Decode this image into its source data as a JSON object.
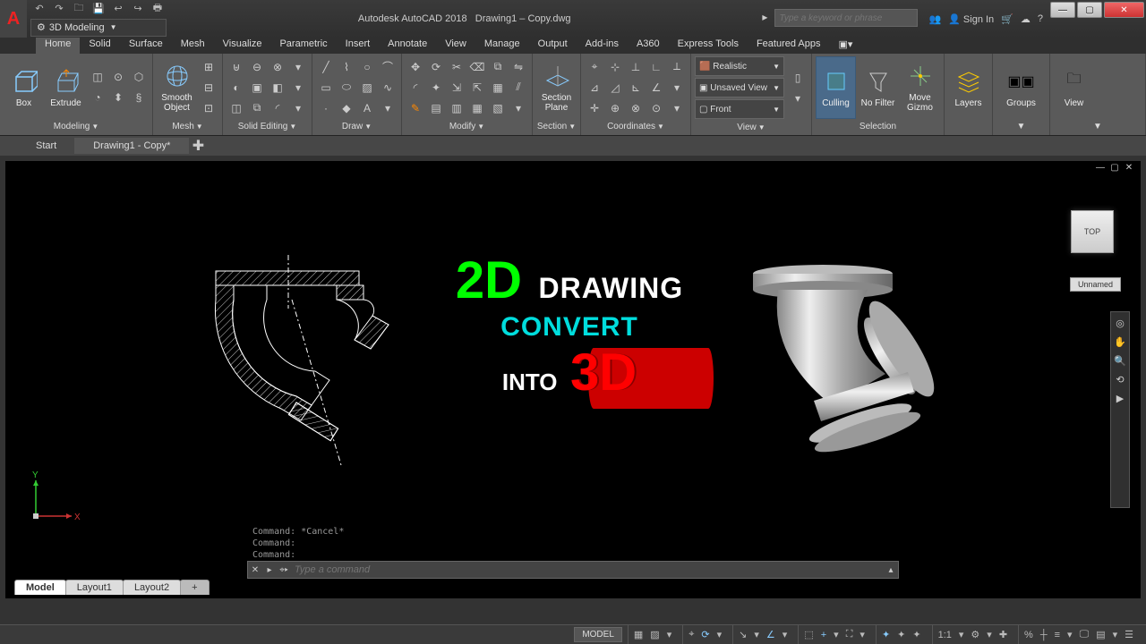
{
  "title_bar": {
    "app_name": "Autodesk AutoCAD 2018",
    "doc_name": "Drawing1 – Copy.dwg",
    "workspace": "3D Modeling",
    "search_placeholder": "Type a keyword or phrase",
    "sign_in": "Sign In",
    "qat": [
      "↶",
      "↷",
      "📁",
      "💾",
      "↩",
      "↪",
      "🖨"
    ]
  },
  "menu_tabs": [
    "Home",
    "Solid",
    "Surface",
    "Mesh",
    "Visualize",
    "Parametric",
    "Insert",
    "Annotate",
    "View",
    "Manage",
    "Output",
    "Add-ins",
    "A360",
    "Express Tools",
    "Featured Apps"
  ],
  "ribbon": {
    "modeling": {
      "title": "Modeling",
      "box": "Box",
      "extrude": "Extrude"
    },
    "mesh": {
      "title": "Mesh",
      "smooth": "Smooth Object"
    },
    "solid_editing": {
      "title": "Solid Editing"
    },
    "draw": {
      "title": "Draw"
    },
    "modify": {
      "title": "Modify"
    },
    "section": {
      "title": "Section",
      "plane": "Section Plane"
    },
    "coordinates": {
      "title": "Coordinates"
    },
    "view": {
      "title": "View",
      "style": "Realistic",
      "saved_view": "Unsaved View",
      "front": "Front"
    },
    "selection": {
      "title": "Selection",
      "culling": "Culling",
      "no_filter": "No Filter",
      "gizmo": "Move Gizmo"
    },
    "layers": {
      "title": "Layers"
    },
    "groups": {
      "title": "Groups"
    },
    "view_panel": {
      "title": "View"
    }
  },
  "doc_tabs": {
    "start": "Start",
    "active": "Drawing1 - Copy*"
  },
  "canvas": {
    "viewcube": "TOP",
    "unnamed": "Unnamed",
    "big_text": {
      "d2": "2D",
      "drawing": "DRAWING",
      "convert": "CONVERT",
      "into": "INTO",
      "d3": "3D"
    },
    "ucs": {
      "x": "X",
      "y": "Y"
    },
    "cmd_history": [
      "Command: *Cancel*",
      "Command:",
      "Command:"
    ],
    "cmd_placeholder": "Type a command"
  },
  "layout_tabs": [
    "Model",
    "Layout1",
    "Layout2"
  ],
  "status": {
    "model": "MODEL",
    "scale": "1:1",
    "icons": [
      "▦",
      "▨",
      "▾",
      "⌖",
      "⟳",
      "▾",
      "↘",
      "▾",
      "∠",
      "▾",
      "⬚",
      "+",
      "▾",
      "⛶",
      "▾",
      "✦",
      "✦",
      "✦",
      "⚙",
      "▾",
      "✚",
      "%",
      "┼",
      "≡",
      "▾",
      "🖵",
      "▤",
      "▾",
      "☰"
    ]
  }
}
